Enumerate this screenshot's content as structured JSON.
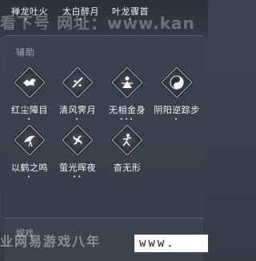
{
  "top_row": {
    "skills": [
      {
        "label": "禅龙吐火",
        "dots": "•"
      },
      {
        "label": "太白醉月",
        "dots": "•"
      },
      {
        "label": "叶龙骤首",
        "dots": "•"
      }
    ]
  },
  "watermark": {
    "top": "看下号 网址：www.kan",
    "bottom": "业网易游戏八年",
    "www": "www."
  },
  "section_assist": {
    "title": "辅助",
    "skills": [
      {
        "label": "红尘障目",
        "dots": "•",
        "icon": "red-dust-icon"
      },
      {
        "label": "清风霁月",
        "dots": "•",
        "icon": "clear-wind-icon"
      },
      {
        "label": "无相金身",
        "dots": "•••",
        "icon": "golden-body-icon"
      },
      {
        "label": "阴阳逆踪步",
        "dots": "•",
        "icon": "yin-yang-icon"
      },
      {
        "label": "以鹤之鸣",
        "dots": "•",
        "icon": "crane-call-icon"
      },
      {
        "label": "萤光晖夜",
        "dots": "••",
        "icon": "firefly-swirl-icon"
      },
      {
        "label": "杳无形",
        "dots": "",
        "icon": "formless-icon"
      }
    ]
  },
  "section_play": {
    "title": "娱戏"
  }
}
